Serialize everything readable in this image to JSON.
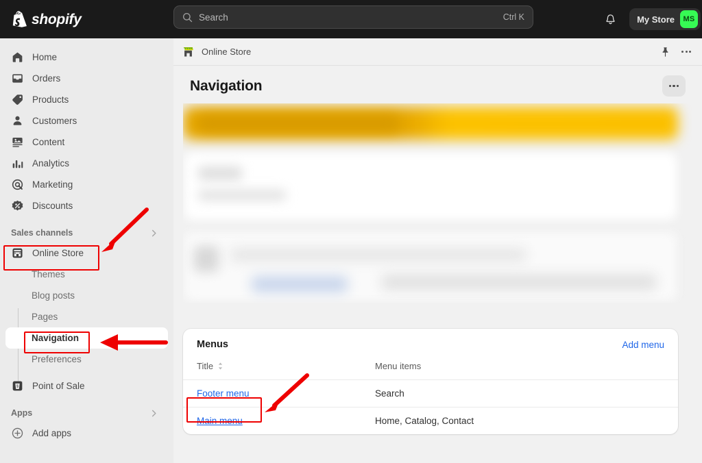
{
  "topbar": {
    "brand": "shopify",
    "brand_icon": "shopify-bag-logo",
    "search": {
      "placeholder": "Search",
      "value": "",
      "shortcut": "Ctrl K",
      "icon": "search-icon"
    },
    "notifications_icon": "bell-icon",
    "store_name": "My Store",
    "avatar_initials": "MS",
    "avatar_color": "#36fa54",
    "background": "#1a1a1a"
  },
  "sidebar": {
    "items": [
      {
        "label": "Home",
        "icon": "home-icon"
      },
      {
        "label": "Orders",
        "icon": "orders-inbox-icon"
      },
      {
        "label": "Products",
        "icon": "product-tag-icon"
      },
      {
        "label": "Customers",
        "icon": "customer-person-icon"
      },
      {
        "label": "Content",
        "icon": "content-media-icon"
      },
      {
        "label": "Analytics",
        "icon": "analytics-bars-icon"
      },
      {
        "label": "Marketing",
        "icon": "marketing-target-icon"
      },
      {
        "label": "Discounts",
        "icon": "discount-badge-icon"
      }
    ],
    "sales_channels": {
      "title": "Sales channels",
      "collapse_icon": "chevron-right-icon",
      "online_store": {
        "label": "Online Store",
        "icon": "storefront-icon"
      },
      "sub_items": [
        {
          "label": "Themes",
          "active": false
        },
        {
          "label": "Blog posts",
          "active": false
        },
        {
          "label": "Pages",
          "active": false
        },
        {
          "label": "Navigation",
          "active": true
        },
        {
          "label": "Preferences",
          "active": false
        }
      ],
      "point_of_sale": {
        "label": "Point of Sale",
        "icon": "point-of-sale-icon"
      }
    },
    "apps": {
      "title": "Apps",
      "collapse_icon": "chevron-right-icon",
      "add_apps": {
        "label": "Add apps",
        "icon": "plus-circle-icon"
      }
    }
  },
  "main": {
    "context_bar": {
      "label": "Online Store",
      "icon": "storefront-icon",
      "pin_icon": "pin-icon",
      "more_icon": "more-horizontal-icon"
    },
    "page_title": "Navigation",
    "page_more_icon": "more-horizontal-icon",
    "menus_card": {
      "title": "Menus",
      "add_menu_label": "Add menu",
      "columns": [
        {
          "label": "Title",
          "sort_icon": "sort-chevrons-icon"
        },
        {
          "label": "Menu items"
        }
      ],
      "rows": [
        {
          "title": "Footer menu",
          "items": "Search"
        },
        {
          "title": "Main menu",
          "items": "Home, Catalog, Contact"
        }
      ]
    }
  },
  "annotations": {
    "color": "#ee0000",
    "boxes": [
      {
        "target": "Online Store"
      },
      {
        "target": "Navigation"
      },
      {
        "target": "Footer menu"
      }
    ],
    "arrows": [
      {
        "points_to": "Online Store"
      },
      {
        "points_to": "Navigation"
      },
      {
        "points_to": "Footer menu"
      }
    ]
  }
}
